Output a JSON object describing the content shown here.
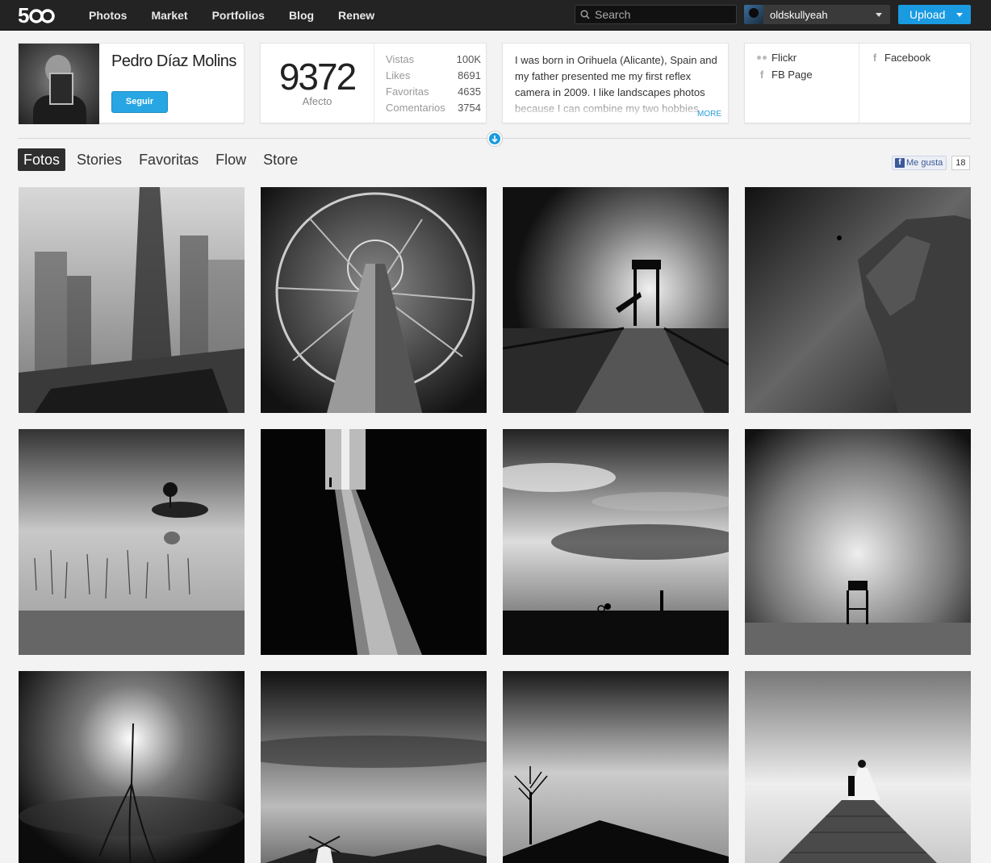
{
  "topbar": {
    "nav": [
      "Photos",
      "Market",
      "Portfolios",
      "Blog",
      "Renew"
    ],
    "search_placeholder": "Search",
    "username": "oldskullyeah",
    "upload_label": "Upload"
  },
  "profile": {
    "name": "Pedro Díaz Molins",
    "follow_label": "Seguir"
  },
  "stats": {
    "affect_value": "9372",
    "affect_label": "Afecto",
    "rows": [
      {
        "label": "Vistas",
        "value": "100K"
      },
      {
        "label": "Likes",
        "value": "8691"
      },
      {
        "label": "Favoritas",
        "value": "4635"
      },
      {
        "label": "Comentarios",
        "value": "3754"
      }
    ]
  },
  "bio": {
    "text": "I was born in Orihuela (Alicante), Spain and my father presented me my first reflex camera in 2009. I like landscapes photos because I can combine my two hobbies",
    "more_label": "MORE"
  },
  "links": {
    "flickr": "Flickr",
    "fb_page": "FB Page",
    "facebook": "Facebook"
  },
  "tabs": [
    "Fotos",
    "Stories",
    "Favoritas",
    "Flow",
    "Store"
  ],
  "like": {
    "label": "Me gusta",
    "count": "18"
  },
  "photos": [
    "skyscrapers",
    "wheel-tower",
    "lifeguard-tower-path",
    "cliff-climber",
    "island-tree",
    "light-beam",
    "cloudy-cyclist",
    "lifeguard-chair",
    "tree-reflection",
    "windmill",
    "lone-tree",
    "pier-couple"
  ]
}
